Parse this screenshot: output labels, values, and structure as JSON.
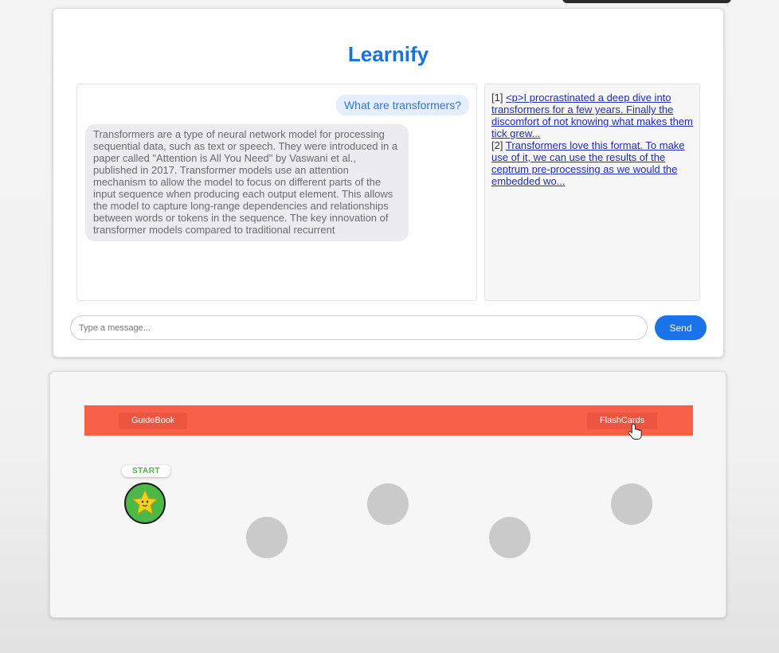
{
  "app": {
    "title": "Learnify"
  },
  "chat": {
    "user_message": "What are transformers?",
    "bot_message": "Transformers are a type of neural network model for processing sequential data, such as text or speech. They were introduced in a paper called \"Attention is All You Need\" by Vaswani et al., published in 2017. Transformer models use an attention mechanism to allow the model to focus on different parts of the input sequence when producing each output element. This allows the model to capture long-range dependencies and relationships between words or tokens in the sequence. The key innovation of transformer models compared to traditional recurrent"
  },
  "sources": [
    {
      "index": "[1]",
      "text": "<p>I procrastinated a deep dive into transformers for a few years. Finally the discomfort of not knowing what makes them tick grew..."
    },
    {
      "index": "[2]",
      "text": "Transformers love this format. To make use of it, we can use the results of the ceptrum pre-processing as we would the embedded wo..."
    }
  ],
  "composer": {
    "placeholder": "Type a message...",
    "send_label": "Send"
  },
  "game": {
    "nav": {
      "guidebook_label": "GuideBook",
      "flashcards_label": "FlashCards"
    },
    "start_label": "START",
    "nodes": [
      {
        "id": "start",
        "state": "active",
        "icon": "star-icon"
      },
      {
        "id": "level-2",
        "state": "locked"
      },
      {
        "id": "level-3",
        "state": "locked"
      },
      {
        "id": "level-4",
        "state": "locked"
      },
      {
        "id": "level-5",
        "state": "locked"
      }
    ]
  },
  "colors": {
    "brand_blue": "#1a73d8",
    "send_button": "#1a73e8",
    "nav_bar": "#f86048",
    "start_green": "#4cb848",
    "locked_node": "#cacaca",
    "link": "#1f2cb6"
  }
}
